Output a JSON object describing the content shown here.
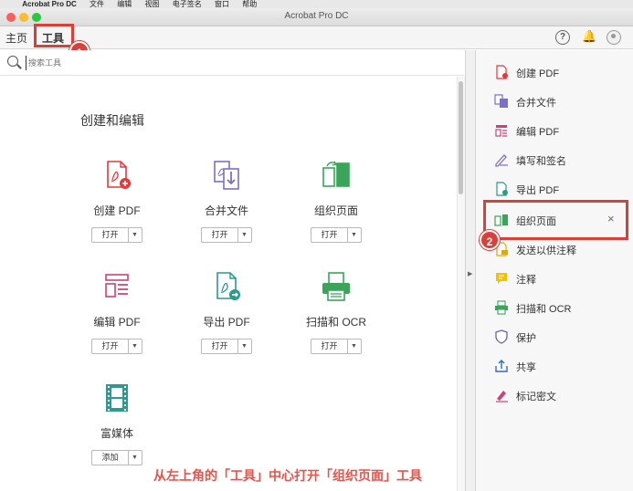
{
  "menubar": {
    "app_name": "Acrobat Pro DC",
    "items": [
      "文件",
      "编辑",
      "视图",
      "电子签名",
      "窗口",
      "帮助"
    ]
  },
  "window": {
    "title": "Acrobat Pro DC"
  },
  "tabs": {
    "home": "主页",
    "tools": "工具"
  },
  "badges": {
    "step1": "1",
    "step2": "2"
  },
  "search": {
    "placeholder": "搜索工具"
  },
  "main": {
    "section_title": "创建和编辑",
    "tools": [
      {
        "label": "创建 PDF",
        "button": "打开"
      },
      {
        "label": "合并文件",
        "button": "打开"
      },
      {
        "label": "组织页面",
        "button": "打开"
      },
      {
        "label": "编辑 PDF",
        "button": "打开"
      },
      {
        "label": "导出 PDF",
        "button": "打开"
      },
      {
        "label": "扫描和 OCR",
        "button": "打开"
      },
      {
        "label": "富媒体",
        "button": "添加"
      }
    ]
  },
  "rightpane": {
    "items": [
      "创建 PDF",
      "合并文件",
      "编辑 PDF",
      "填写和签名",
      "导出 PDF",
      "组织页面",
      "发送以供注释",
      "注释",
      "扫描和 OCR",
      "保护",
      "共享",
      "标记密文"
    ]
  },
  "caption": "从左上角的「工具」中心打开「组织页面」工具",
  "colors": {
    "accent_red": "#d9403a",
    "acrobat_red": "#e5383b",
    "tool_purple": "#7b6fc7",
    "tool_green": "#3aa55a",
    "tool_pink": "#c9437a",
    "tool_teal": "#2c9a8c"
  }
}
